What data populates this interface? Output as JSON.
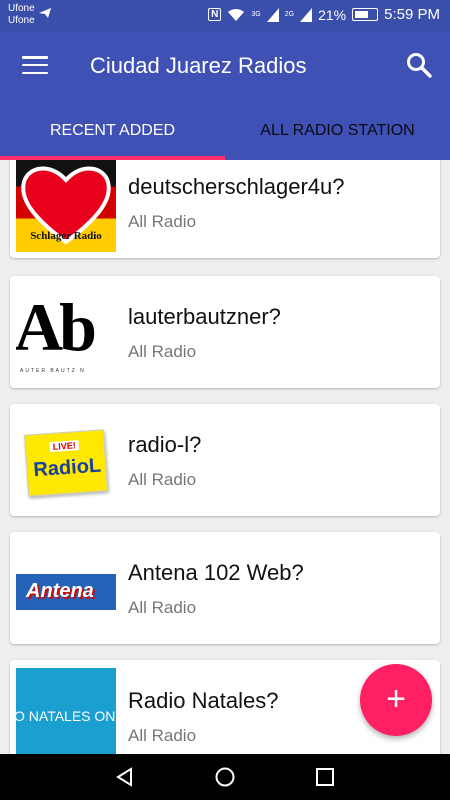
{
  "status_bar": {
    "carrier_1": "Ufone",
    "carrier_2": "Ufone",
    "nfc": "N",
    "network_1": "3G",
    "network_2": "2G",
    "battery_percent": "21%",
    "time": "5:59 PM"
  },
  "app_bar": {
    "title": "Ciudad Juarez Radios",
    "menu_icon": "hamburger-menu-icon",
    "search_icon": "search-icon"
  },
  "tabs": [
    {
      "label": "RECENT ADDED",
      "active": true
    },
    {
      "label": "ALL RADIO STATION",
      "active": false
    }
  ],
  "stations": [
    {
      "name": "deutscherschlager4u?",
      "category": "All Radio",
      "logo_text": "Schlager Radio"
    },
    {
      "name": "lauterbautzner?",
      "category": "All Radio",
      "logo_text": "Ab",
      "logo_subtext": "AUTER BAUTZ N"
    },
    {
      "name": "radio-l?",
      "category": "All Radio",
      "logo_badge": "LIVE!",
      "logo_text": "RadioL"
    },
    {
      "name": "Antena 102 Web?",
      "category": "All Radio",
      "logo_text": "Antena"
    },
    {
      "name": "Radio Natales?",
      "category": "All Radio",
      "logo_text": "O NATALES ON"
    }
  ],
  "fab": {
    "label": "+",
    "icon": "add-icon"
  },
  "nav": {
    "back_icon": "back-icon",
    "home_icon": "home-icon",
    "recents_icon": "recents-icon"
  },
  "colors": {
    "app_bar": "#3f51b5",
    "status_bar": "#3a4eac",
    "accent": "#ff2d6f",
    "fab": "#ff1f63"
  }
}
